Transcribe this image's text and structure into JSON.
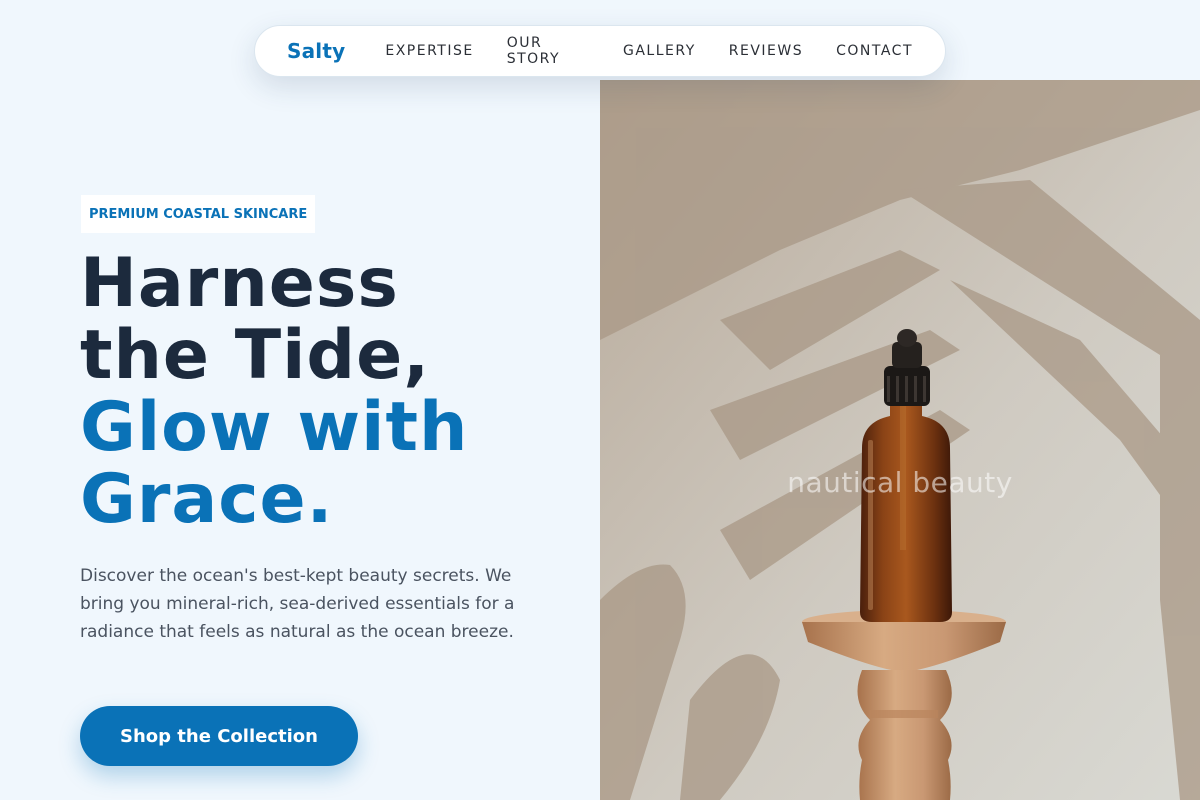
{
  "nav": {
    "brand": "Salty",
    "links": [
      "EXPERTISE",
      "OUR STORY",
      "GALLERY",
      "REVIEWS",
      "CONTACT"
    ]
  },
  "hero": {
    "tagline": "PREMIUM COASTAL SKINCARE",
    "headline_line1": "Harness",
    "headline_line2": "the Tide,",
    "headline_line3": "Glow with",
    "headline_line4": "Grace.",
    "description": "Discover the ocean's best-kept beauty secrets. We bring you mineral-rich, sea-derived essentials for a radiance that feels as natural as the ocean breeze.",
    "cta_label": "Shop the Collection",
    "image_watermark": "nautical beauty"
  },
  "colors": {
    "accent": "#0a72b7",
    "headline_dark": "#1c2a3d",
    "background": "#f0f7fd"
  }
}
